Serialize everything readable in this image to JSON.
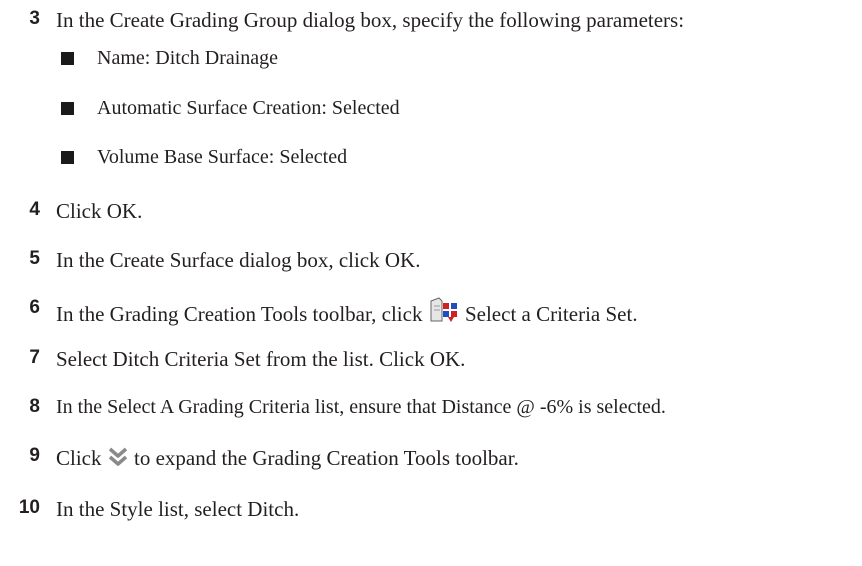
{
  "steps": {
    "s3": {
      "number": "3",
      "text": "In the Create Grading Group dialog box, specify the following parameters:",
      "bullets": [
        "Name: Ditch Drainage",
        "Automatic Surface Creation: Selected",
        "Volume Base Surface: Selected"
      ]
    },
    "s4": {
      "number": "4",
      "text": "Click OK."
    },
    "s5": {
      "number": "5",
      "text": "In the Create Surface dialog box, click OK."
    },
    "s6": {
      "number": "6",
      "text_before": "In the Grading Creation Tools toolbar, click",
      "icon": "select-criteria-set-icon",
      "text_after": "Select a Criteria Set."
    },
    "s7": {
      "number": "7",
      "text": "Select Ditch Criteria Set from the list. Click OK."
    },
    "s8": {
      "number": "8",
      "text": "In the Select A Grading Criteria list, ensure that Distance @ -6% is selected."
    },
    "s9": {
      "number": "9",
      "text_before": "Click",
      "icon": "expand-chevrons-icon",
      "text_after": "to expand the Grading Creation Tools toolbar."
    },
    "s10": {
      "number": "10",
      "text": "In the Style list, select Ditch."
    }
  }
}
